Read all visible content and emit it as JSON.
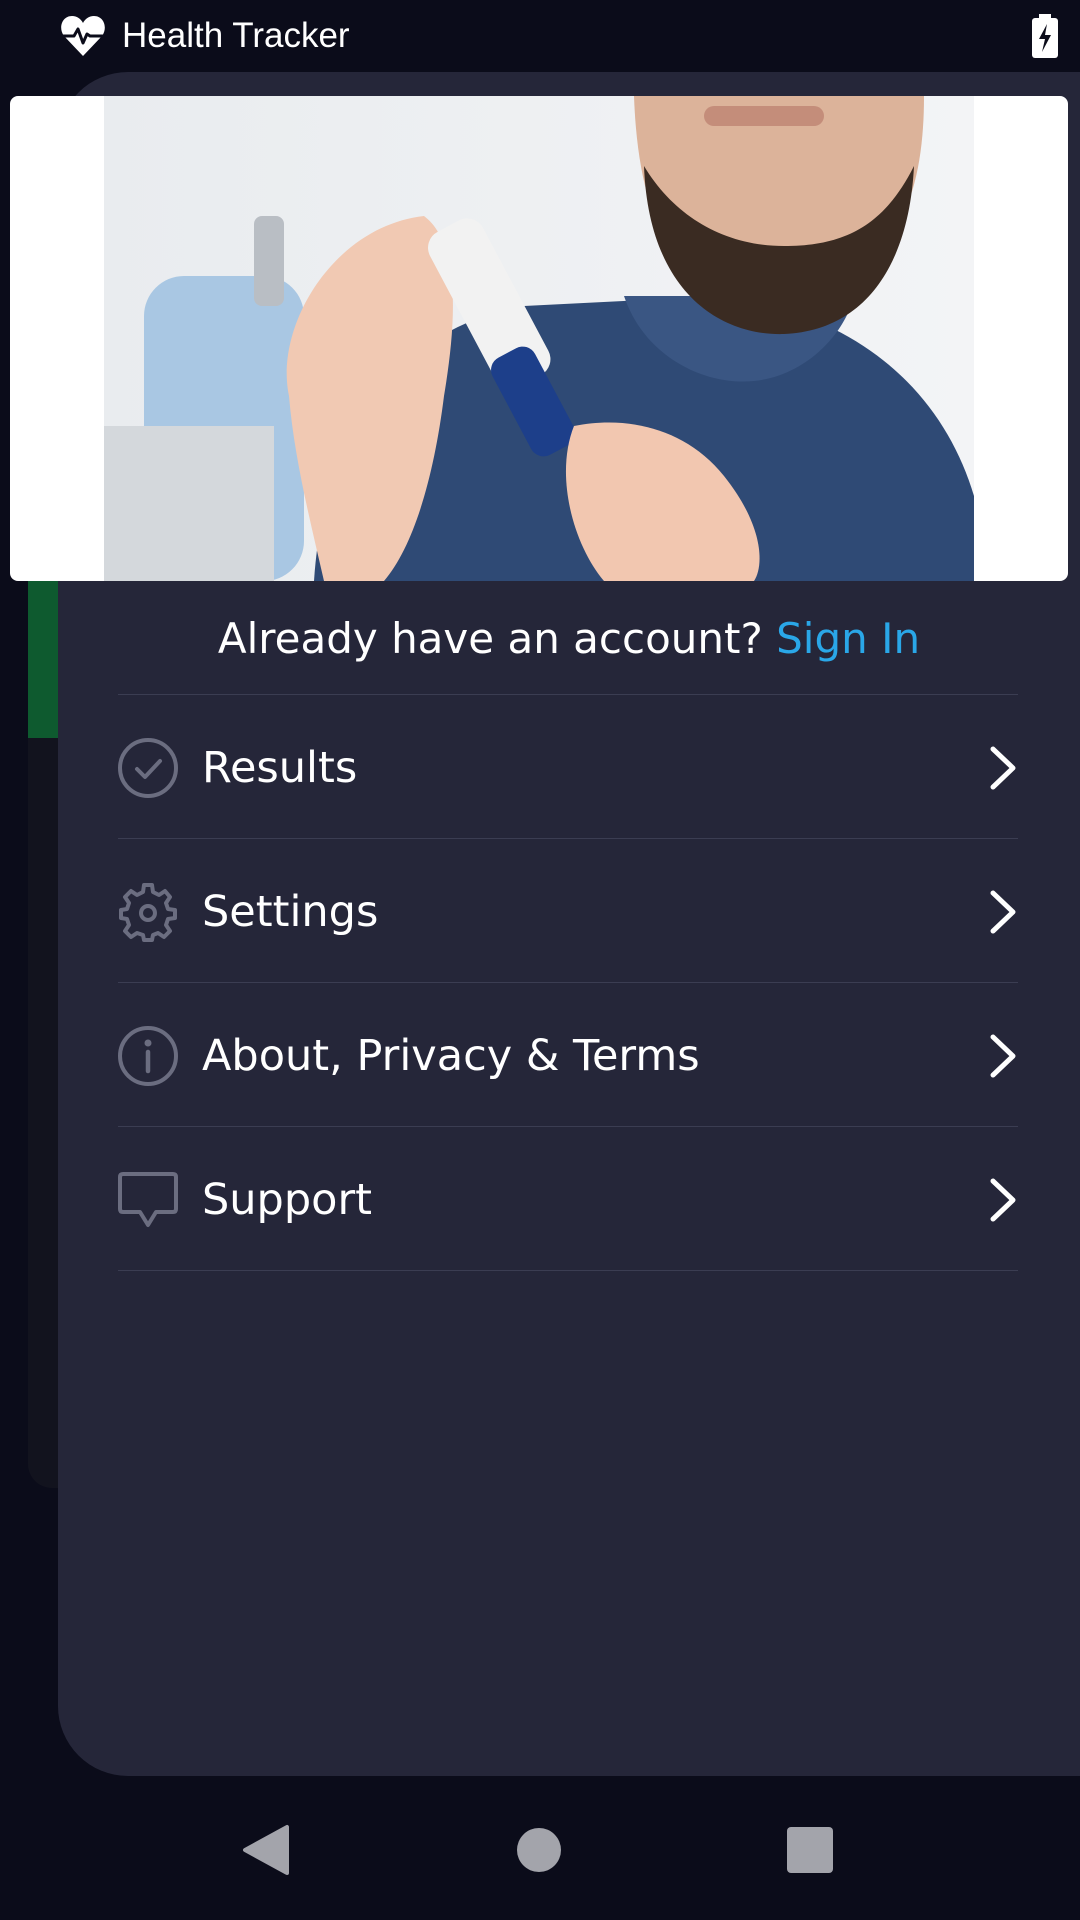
{
  "status_bar": {
    "app_title": "Health Tracker",
    "app_icon": "heart-pulse-icon",
    "battery_icon": "battery-charging-icon"
  },
  "hero": {
    "image": "man-using-glucose-lancet-photo"
  },
  "account": {
    "prompt": "Already have an account? ",
    "sign_in": "Sign In"
  },
  "menu": {
    "items": [
      {
        "label": "Results",
        "icon": "check-circle-icon"
      },
      {
        "label": "Settings",
        "icon": "gear-icon"
      },
      {
        "label": "About, Privacy & Terms",
        "icon": "info-icon"
      },
      {
        "label": "Support",
        "icon": "chat-bubble-icon"
      }
    ],
    "chevron_icon": "chevron-right-icon"
  },
  "nav": {
    "back": "back-triangle-icon",
    "home": "home-circle-icon",
    "recents": "recents-square-icon"
  },
  "colors": {
    "background": "#0b0c1a",
    "drawer": "#252639",
    "accent": "#2aa7e8",
    "icon_gray": "#6b6d80"
  }
}
